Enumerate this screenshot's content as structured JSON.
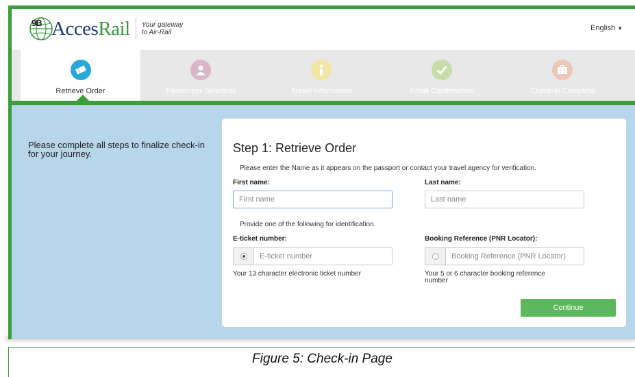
{
  "header": {
    "logo_badge": "9B",
    "logo_word_1": "Acces",
    "logo_word_2": "Rail",
    "tagline_line1": "Your gateway",
    "tagline_line2": "to Air-Rail",
    "language": "English"
  },
  "steps": [
    {
      "label": "Retrieve Order",
      "icon": "ticket-icon",
      "color": "#29a8d8",
      "active": true
    },
    {
      "label": "Passenger Selection",
      "icon": "user-icon",
      "color": "#d9b7c9",
      "active": false
    },
    {
      "label": "Travel Information",
      "icon": "info-icon",
      "color": "#f2e6a5",
      "active": false
    },
    {
      "label": "Email Confirmation",
      "icon": "check-icon",
      "color": "#c8dca8",
      "active": false
    },
    {
      "label": "Check-in Complete",
      "icon": "luggage-icon",
      "color": "#ecc7b7",
      "active": false
    }
  ],
  "intro": "Please complete all steps to finalize check-in for your journey.",
  "form": {
    "title": "Step 1: Retrieve Order",
    "instructions": "Please enter the Name as it appears on the passport or contact your travel agency for verification.",
    "first_name_label": "First name:",
    "first_name_placeholder": "First name",
    "last_name_label": "Last name:",
    "last_name_placeholder": "Last name",
    "ident_note": "Provide one of the following for identification.",
    "eticket_label": "E-ticket number:",
    "eticket_placeholder": "E-ticket number",
    "eticket_help": "Your 13 character electronic ticket number",
    "pnr_label": "Booking Reference (PNR Locator):",
    "pnr_placeholder": "Booking Reference (PNR Locator)",
    "pnr_help_line1": "Your 5 or 6 character booking reference",
    "pnr_help_line2": "number",
    "continue_label": "Continue"
  },
  "caption": "Figure 5: Check-in Page",
  "colors": {
    "frame_green": "#3b9e3b",
    "main_bg": "#b7d6e9",
    "button_green": "#5cb85c"
  }
}
